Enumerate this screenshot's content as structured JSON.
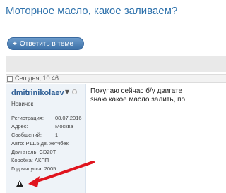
{
  "thread": {
    "title": "Моторное масло, какое заливаем?"
  },
  "toolbar": {
    "reply_label": "Ответить в теме",
    "reply_icon": "+"
  },
  "post": {
    "date": "Сегодня, 10:46",
    "body_line1": "Покупаю сейчас б/у двигате",
    "body_line2": "знаю какое масло залить, по"
  },
  "user": {
    "name": "dmitrinikolaev",
    "rank": "Новичок",
    "stats": [
      {
        "label": "Регистрация:",
        "value": "08.07.2016"
      },
      {
        "label": "Адрес:",
        "value": "Москва"
      },
      {
        "label": "Сообщений:",
        "value": "1"
      }
    ],
    "details": [
      "Авто: P11.5 дв. хетчбек",
      "Двигатель: CD20T",
      "Коробка: АКПП",
      "Год выпуска: 2005"
    ]
  },
  "colors": {
    "link": "#2f72ac",
    "button": "#4a7db3",
    "arrow": "#e0141e"
  }
}
